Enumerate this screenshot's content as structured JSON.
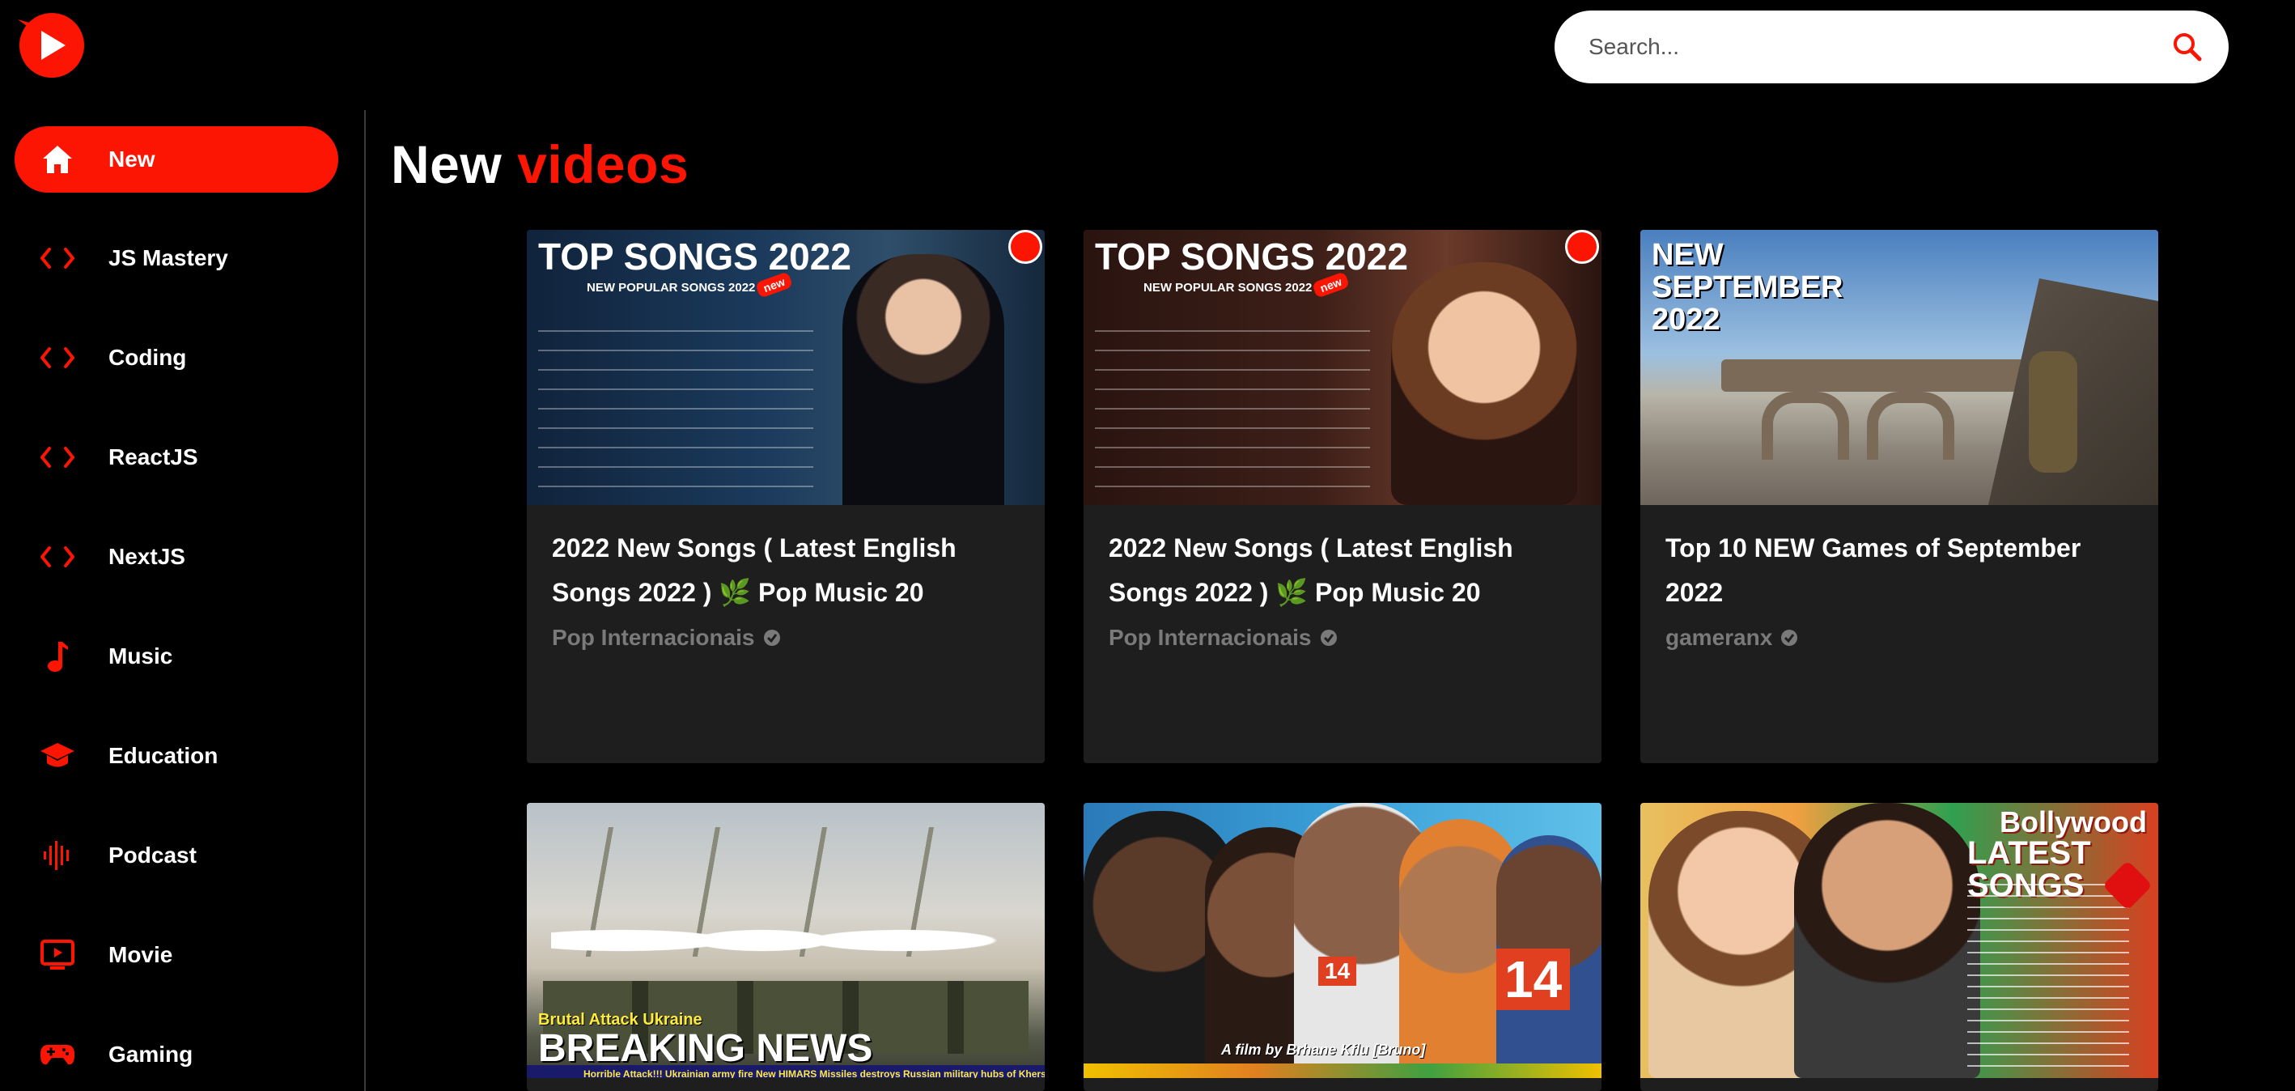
{
  "search": {
    "placeholder": "Search..."
  },
  "sidebar": {
    "items": [
      {
        "label": "New",
        "icon": "home-icon",
        "active": true
      },
      {
        "label": "JS Mastery",
        "icon": "code-icon"
      },
      {
        "label": "Coding",
        "icon": "code-icon"
      },
      {
        "label": "ReactJS",
        "icon": "code-icon"
      },
      {
        "label": "NextJS",
        "icon": "code-icon"
      },
      {
        "label": "Music",
        "icon": "music-note-icon"
      },
      {
        "label": "Education",
        "icon": "graduation-cap-icon"
      },
      {
        "label": "Podcast",
        "icon": "soundwave-icon"
      },
      {
        "label": "Movie",
        "icon": "tv-icon"
      },
      {
        "label": "Gaming",
        "icon": "gamepad-icon"
      }
    ]
  },
  "main": {
    "heading_word": "New",
    "heading_accent": "videos",
    "videos": [
      {
        "thumb_title": "TOP SONGS 2022",
        "thumb_subtitle": "NEW POPULAR SONGS 2022",
        "thumb_badge": "new",
        "title": "2022 New Songs ( Latest English Songs 2022 ) 🌿 Pop Music 20",
        "channel": "Pop Internacionais"
      },
      {
        "thumb_title": "TOP SONGS 2022",
        "thumb_subtitle": "NEW POPULAR SONGS 2022",
        "thumb_badge": "new",
        "title": "2022 New Songs ( Latest English Songs 2022 ) 🌿 Pop Music 20",
        "channel": "Pop Internacionais"
      },
      {
        "thumb_title": "NEW SEPTEMBER 2022",
        "title": "Top 10 NEW Games of September 2022",
        "channel": "gameranx"
      },
      {
        "thumb_caption": "Brutal Attack Ukraine",
        "thumb_title": "BREAKING NEWS",
        "thumb_ticker": "Horrible Attack!!! Ukrainian army fire New HIMARS Missiles destroys Russian military hubs of Kherson"
      },
      {
        "thumb_number": "14",
        "thumb_caption": "A film by Brhane Kflu [Bruno]"
      },
      {
        "thumb_title": "Bollywood",
        "thumb_subtitle": "LATEST SONGS"
      }
    ]
  },
  "colors": {
    "accent": "#fc1503",
    "card": "#1e1e1e",
    "channel": "#7a7a7a"
  }
}
